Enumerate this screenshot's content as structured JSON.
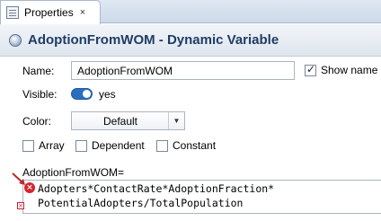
{
  "tab": {
    "title": "Properties",
    "close_glyph": "×",
    "icon": "properties-icon"
  },
  "header": {
    "title": "AdoptionFromWOM - Dynamic Variable",
    "icon": "variable-icon"
  },
  "form": {
    "name_label": "Name:",
    "name_value": "AdoptionFromWOM",
    "show_name_label": "Show name",
    "show_name_checked": true,
    "visible_label": "Visible:",
    "visible_value": "yes",
    "color_label": "Color:",
    "color_value": "Default",
    "checkboxes": [
      {
        "label": "Array",
        "checked": false
      },
      {
        "label": "Dependent",
        "checked": false
      },
      {
        "label": "Constant",
        "checked": false
      }
    ]
  },
  "code": {
    "label": "AdoptionFromWOM=",
    "lines": [
      "Adopters*ContactRate*AdoptionFraction*",
      "PotentialAdopters/TotalPopulation"
    ],
    "error_glyph": "×",
    "error_color": "#d6262b"
  },
  "colors": {
    "header_text": "#1f3c66",
    "toggle_on": "#2a6fbf"
  }
}
